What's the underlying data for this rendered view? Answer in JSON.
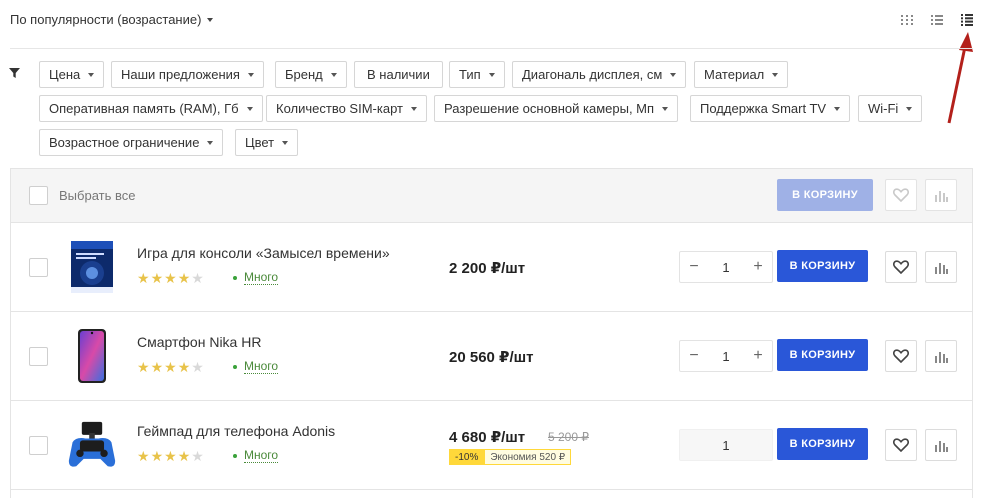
{
  "sort": {
    "label": "По популярности (возрастание)"
  },
  "view_icons": [
    "grid-view-icon",
    "list-view-icon",
    "compact-list-view-icon"
  ],
  "filters": [
    "Цена",
    "Наши предложения",
    "Бренд",
    "В наличии",
    "Тип",
    "Диагональ дисплея, см",
    "Материал",
    "Оперативная память (RAM), Гб",
    "Количество SIM-карт",
    "Разрешение основной камеры, Мп",
    "Поддержка Smart TV",
    "Wi-Fi",
    "Возрастное ограничение",
    "Цвет"
  ],
  "select_all": {
    "label": "Выбрать все",
    "cart_label": "В КОРЗИНУ"
  },
  "products": [
    {
      "name": "Игра для консоли «Замысел времени»",
      "rating": 4,
      "stock": "Много",
      "price": "2 200 ₽/шт",
      "old_price": "",
      "discount": "",
      "savings": "",
      "qty": "1",
      "cart_label": "В КОРЗИНУ"
    },
    {
      "name": "Смартфон Nika HR",
      "rating": 4,
      "stock": "Много",
      "price": "20 560 ₽/шт",
      "old_price": "",
      "discount": "",
      "savings": "",
      "qty": "1",
      "cart_label": "В КОРЗИНУ"
    },
    {
      "name": "Геймпад для телефона Adonis",
      "rating": 4,
      "stock": "Много",
      "price": "4 680 ₽/шт",
      "old_price": "5 200 ₽",
      "discount": "-10%",
      "savings": "Экономия 520 ₽",
      "qty": "1",
      "cart_label": "В КОРЗИНУ"
    }
  ],
  "colors": {
    "accent": "#2a57d8",
    "accent_disabled": "#9fb1e6",
    "star": "#e8c34a",
    "stock": "#4a8a3a",
    "annotation_arrow": "#b3201b"
  }
}
